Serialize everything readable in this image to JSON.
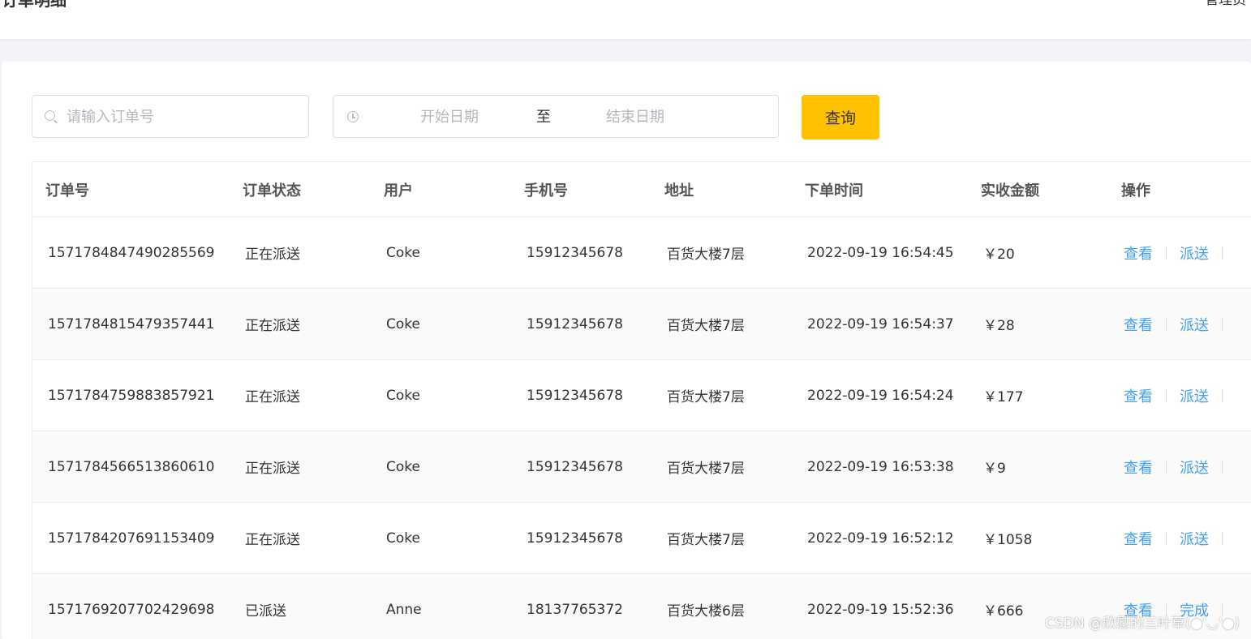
{
  "header": {
    "title": "订单明细",
    "user": "管理员"
  },
  "filters": {
    "order_placeholder": "请输入订单号",
    "start_placeholder": "开始日期",
    "range_separator": "至",
    "end_placeholder": "结束日期",
    "query_label": "查询"
  },
  "colors": {
    "accent": "#ffc200",
    "link": "#419eff"
  },
  "table": {
    "columns": [
      "订单号",
      "订单状态",
      "用户",
      "手机号",
      "地址",
      "下单时间",
      "实收金额",
      "操作"
    ],
    "rows": [
      {
        "order_no": "1571784847490285569",
        "status": "正在派送",
        "user": "Coke",
        "phone": "15912345678",
        "address": "百货大楼7层",
        "time": "2022-09-19 16:54:45",
        "amount": "￥20",
        "action_view": "查看",
        "action_primary": "派送"
      },
      {
        "order_no": "1571784815479357441",
        "status": "正在派送",
        "user": "Coke",
        "phone": "15912345678",
        "address": "百货大楼7层",
        "time": "2022-09-19 16:54:37",
        "amount": "￥28",
        "action_view": "查看",
        "action_primary": "派送"
      },
      {
        "order_no": "1571784759883857921",
        "status": "正在派送",
        "user": "Coke",
        "phone": "15912345678",
        "address": "百货大楼7层",
        "time": "2022-09-19 16:54:24",
        "amount": "￥177",
        "action_view": "查看",
        "action_primary": "派送"
      },
      {
        "order_no": "1571784566513860610",
        "status": "正在派送",
        "user": "Coke",
        "phone": "15912345678",
        "address": "百货大楼7层",
        "time": "2022-09-19 16:53:38",
        "amount": "￥9",
        "action_view": "查看",
        "action_primary": "派送"
      },
      {
        "order_no": "1571784207691153409",
        "status": "正在派送",
        "user": "Coke",
        "phone": "15912345678",
        "address": "百货大楼7层",
        "time": "2022-09-19 16:52:12",
        "amount": "￥1058",
        "action_view": "查看",
        "action_primary": "派送"
      },
      {
        "order_no": "1571769207702429698",
        "status": "已派送",
        "user": "Anne",
        "phone": "18137765372",
        "address": "百货大楼6层",
        "time": "2022-09-19 15:52:36",
        "amount": "￥666",
        "action_view": "查看",
        "action_primary": "完成"
      }
    ]
  },
  "watermark": "CSDN @欣慰的三叶草(●'◡'●)"
}
